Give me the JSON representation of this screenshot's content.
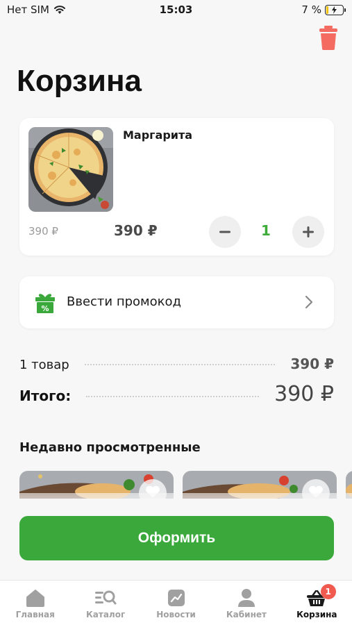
{
  "status_bar": {
    "carrier": "Нет SIM",
    "time": "15:03",
    "battery": "7 %"
  },
  "header": {
    "title": "Корзина",
    "trash_icon": "trash-icon",
    "trash_color": "#f36b61"
  },
  "cart_item": {
    "name": "Маргарита",
    "old_price": "390 ₽",
    "price": "390 ₽",
    "quantity": "1",
    "minus_icon": "minus-icon",
    "plus_icon": "plus-icon"
  },
  "promo": {
    "label": "Ввести промокод",
    "icon": "gift-icon"
  },
  "summary": {
    "items_label": "1 товар",
    "items_price": "390 ₽",
    "total_label": "Итого:",
    "total_price": "390 ₽"
  },
  "recent": {
    "title": "Недавно просмотренные"
  },
  "checkout": {
    "label": "Оформить"
  },
  "tabbar": {
    "tabs": [
      {
        "label": "Главная",
        "icon": "home-icon"
      },
      {
        "label": "Каталог",
        "icon": "catalog-search-icon"
      },
      {
        "label": "Новости",
        "icon": "news-chart-icon"
      },
      {
        "label": "Кабинет",
        "icon": "user-icon"
      },
      {
        "label": "Корзина",
        "icon": "basket-icon",
        "badge": "1",
        "active": true
      }
    ]
  },
  "colors": {
    "accent_green": "#3aa83a",
    "qty_green": "#3cab3a",
    "badge_red": "#f05a4f"
  }
}
